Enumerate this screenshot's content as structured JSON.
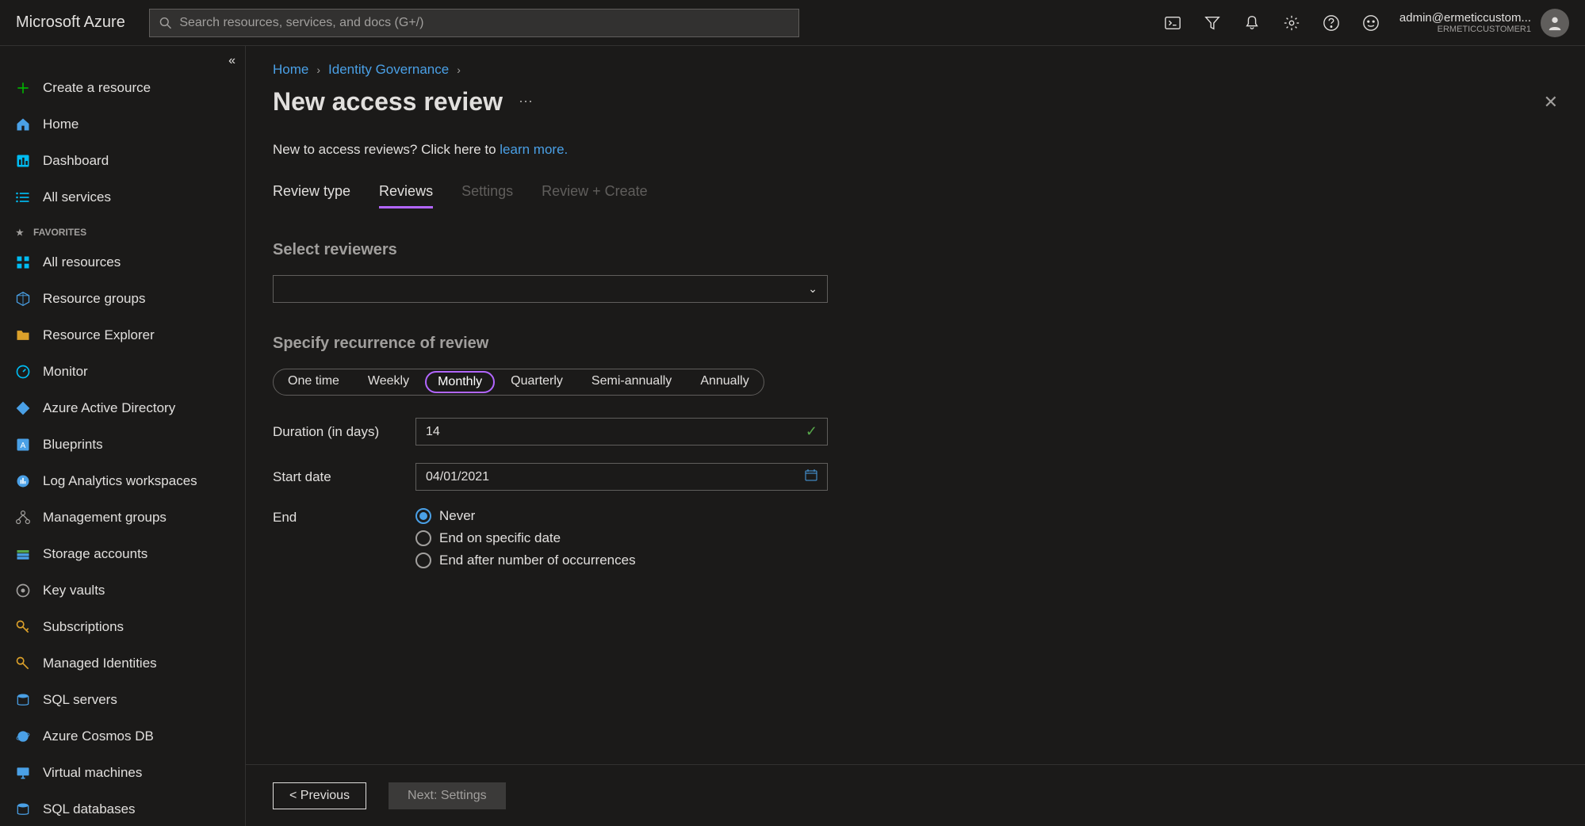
{
  "header": {
    "brand": "Microsoft Azure",
    "search_placeholder": "Search resources, services, and docs (G+/)",
    "account_email": "admin@ermeticcustom...",
    "account_tenant": "ERMETICCUSTOMER1"
  },
  "sidebar": {
    "favorites_label": "FAVORITES",
    "items": [
      {
        "label": "Create a resource",
        "icon": "plus-icon"
      },
      {
        "label": "Home",
        "icon": "home-icon"
      },
      {
        "label": "Dashboard",
        "icon": "dashboard-icon"
      },
      {
        "label": "All services",
        "icon": "list-icon"
      }
    ],
    "favorites": [
      {
        "label": "All resources",
        "icon": "grid-icon"
      },
      {
        "label": "Resource groups",
        "icon": "cube-icon"
      },
      {
        "label": "Resource Explorer",
        "icon": "folder-icon"
      },
      {
        "label": "Monitor",
        "icon": "gauge-icon"
      },
      {
        "label": "Azure Active Directory",
        "icon": "diamond-icon"
      },
      {
        "label": "Blueprints",
        "icon": "blueprint-icon"
      },
      {
        "label": "Log Analytics workspaces",
        "icon": "log-icon"
      },
      {
        "label": "Management groups",
        "icon": "mgmt-icon"
      },
      {
        "label": "Storage accounts",
        "icon": "storage-icon"
      },
      {
        "label": "Key vaults",
        "icon": "keyvault-icon"
      },
      {
        "label": "Subscriptions",
        "icon": "key-icon"
      },
      {
        "label": "Managed Identities",
        "icon": "key-icon"
      },
      {
        "label": "SQL servers",
        "icon": "sql-icon"
      },
      {
        "label": "Azure Cosmos DB",
        "icon": "cosmos-icon"
      },
      {
        "label": "Virtual machines",
        "icon": "vm-icon"
      },
      {
        "label": "SQL databases",
        "icon": "sql-icon"
      }
    ]
  },
  "breadcrumb": {
    "home": "Home",
    "identity": "Identity Governance"
  },
  "page": {
    "title": "New access review",
    "intro_text": "New to access reviews? Click here to ",
    "intro_link": "learn more."
  },
  "tabs": [
    {
      "label": "Review type",
      "state": "normal"
    },
    {
      "label": "Reviews",
      "state": "active"
    },
    {
      "label": "Settings",
      "state": "disabled"
    },
    {
      "label": "Review + Create",
      "state": "disabled"
    }
  ],
  "form": {
    "select_reviewers_title": "Select reviewers",
    "recurrence_title": "Specify recurrence of review",
    "pills": [
      "One time",
      "Weekly",
      "Monthly",
      "Quarterly",
      "Semi-annually",
      "Annually"
    ],
    "pill_active_index": 2,
    "duration_label": "Duration (in days)",
    "duration_value": "14",
    "start_date_label": "Start date",
    "start_date_value": "04/01/2021",
    "end_label": "End",
    "end_options": [
      "Never",
      "End on specific date",
      "End after number of occurrences"
    ],
    "end_selected_index": 0
  },
  "footer": {
    "prev": "< Previous",
    "next": "Next: Settings"
  }
}
